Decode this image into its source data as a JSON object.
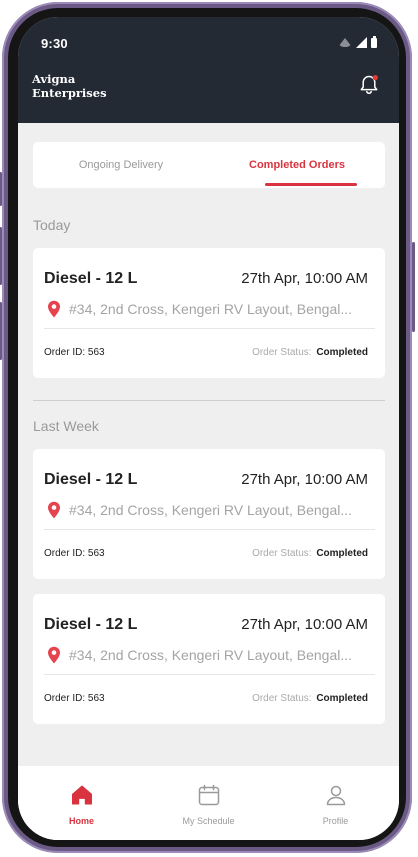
{
  "status_bar": {
    "time": "9:30"
  },
  "header": {
    "brand_name": "Avigna Enterprises",
    "notification_icon": "bell-icon"
  },
  "tabs": [
    {
      "label": "Ongoing Delivery",
      "active": false
    },
    {
      "label": "Completed Orders",
      "active": true
    }
  ],
  "sections": [
    {
      "label": "Today"
    },
    {
      "label": "Last Week"
    }
  ],
  "orders": [
    {
      "product": "Diesel - 12 L",
      "datetime": "27th Apr, 10:00 AM",
      "address": "#34, 2nd Cross, Kengeri RV Layout, Bengal...",
      "order_id": "Order ID: 563",
      "status_label": "Order Status:",
      "status_value": "Completed"
    },
    {
      "product": "Diesel - 12 L",
      "datetime": "27th Apr, 10:00 AM",
      "address": "#34, 2nd Cross, Kengeri RV Layout, Bengal...",
      "order_id": "Order ID: 563",
      "status_label": "Order Status:",
      "status_value": "Completed"
    },
    {
      "product": "Diesel - 12 L",
      "datetime": "27th Apr, 10:00 AM",
      "address": "#34, 2nd Cross, Kengeri RV Layout, Bengal...",
      "order_id": "Order ID: 563",
      "status_label": "Order Status:",
      "status_value": "Completed"
    }
  ],
  "bottom_nav": [
    {
      "label": "Home",
      "icon": "home-icon",
      "active": true
    },
    {
      "label": "My Schedule",
      "icon": "calendar-icon",
      "active": false
    },
    {
      "label": "Profile",
      "icon": "user-icon",
      "active": false
    }
  ],
  "colors": {
    "accent": "#d9333f",
    "header_bg": "#232a33",
    "page_bg": "#efefef"
  }
}
